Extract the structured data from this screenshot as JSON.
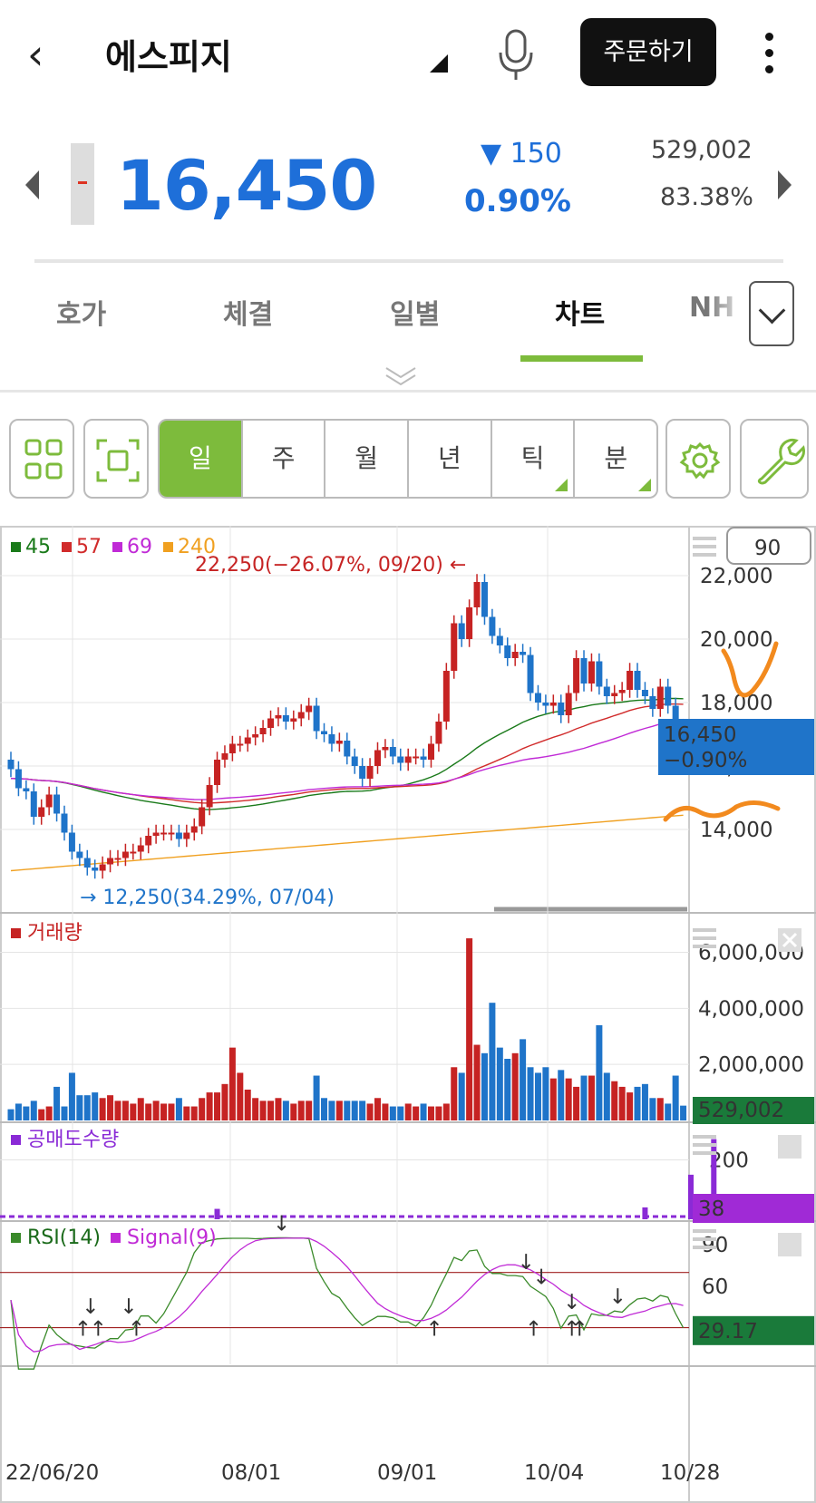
{
  "header": {
    "back_icon": "chevron-left-icon",
    "stock_name": "에스피지",
    "order_button": "주문하기",
    "mic_icon": "microphone-icon",
    "more_icon": "more-vertical-icon"
  },
  "quote": {
    "price": "16,450",
    "change": "▼ 150",
    "change_pct": "0.90%",
    "volume": "529,002",
    "ratio": "83.38%",
    "color": "#1e6fd9"
  },
  "tabs": [
    {
      "label": "호가"
    },
    {
      "label": "체결"
    },
    {
      "label": "일별"
    },
    {
      "label": "차트",
      "active": true
    },
    {
      "label": "NH"
    }
  ],
  "toolbar": {
    "periods": [
      "일",
      "주",
      "월",
      "년",
      "틱",
      "분"
    ],
    "active_period": "일",
    "accent": "#7dbb3c"
  },
  "chart_data": [
    {
      "type": "candlestick",
      "panel": "price",
      "legend": [
        {
          "name": "45",
          "color": "#1a7a1a"
        },
        {
          "name": "57",
          "color": "#d12b2b"
        },
        {
          "name": "69",
          "color": "#c02ad6"
        },
        {
          "name": "240",
          "color": "#f0a020"
        }
      ],
      "period_input": "90",
      "y_ticks": [
        "22,000",
        "20,000",
        "18,000",
        "14,000"
      ],
      "ylim": [
        12000,
        23000
      ],
      "high_annotation": "22,250(−26.07%, 09/20)",
      "low_annotation": "12,250(34.29%, 07/04)",
      "current_label": "16,450",
      "current_change": "−0.90%",
      "current_covered_tick": "16,000",
      "closes": [
        15900,
        15300,
        15200,
        14400,
        14700,
        15100,
        14500,
        13900,
        13300,
        13100,
        12800,
        12700,
        12900,
        13100,
        13100,
        13300,
        13300,
        13500,
        13800,
        13900,
        13900,
        13900,
        13700,
        13900,
        14100,
        14700,
        15400,
        16200,
        16400,
        16700,
        16700,
        16900,
        17000,
        17200,
        17500,
        17600,
        17400,
        17500,
        17700,
        17900,
        17100,
        17000,
        16700,
        16800,
        16300,
        16000,
        15600,
        16000,
        16500,
        16600,
        16300,
        16100,
        16300,
        16300,
        16200,
        16700,
        17400,
        19000,
        20500,
        20000,
        21000,
        21800,
        20700,
        20100,
        19800,
        19400,
        19600,
        19500,
        18300,
        18000,
        17900,
        18000,
        17600,
        18300,
        19400,
        18600,
        19300,
        18500,
        18200,
        18300,
        18400,
        19000,
        18400,
        18200,
        17800,
        18500,
        17900,
        16700,
        16450
      ]
    },
    {
      "type": "bar",
      "panel": "volume",
      "title": "거래량",
      "y_ticks": [
        "6,000,000",
        "4,000,000",
        "2,000,000"
      ],
      "ylim": [
        0,
        6600000
      ],
      "current_label": "529,002",
      "values": [
        400000,
        600000,
        500000,
        700000,
        400000,
        500000,
        1200000,
        500000,
        1700000,
        900000,
        900000,
        1000000,
        800000,
        900000,
        700000,
        700000,
        600000,
        800000,
        600000,
        700000,
        600000,
        600000,
        800000,
        500000,
        500000,
        800000,
        1000000,
        1000000,
        1300000,
        2600000,
        1700000,
        1100000,
        800000,
        700000,
        700000,
        800000,
        700000,
        600000,
        700000,
        700000,
        1600000,
        800000,
        700000,
        700000,
        700000,
        700000,
        700000,
        600000,
        800000,
        600000,
        500000,
        500000,
        600000,
        500000,
        600000,
        500000,
        500000,
        600000,
        1900000,
        1700000,
        6500000,
        2700000,
        2400000,
        4200000,
        2600000,
        2200000,
        2400000,
        2900000,
        1900000,
        1700000,
        1900000,
        1500000,
        1800000,
        1500000,
        1200000,
        1600000,
        1600000,
        3400000,
        1700000,
        1400000,
        1200000,
        1000000,
        1200000,
        1300000,
        800000,
        800000,
        600000,
        1600000,
        529002
      ],
      "colors_up": "#c62323",
      "colors_down": "#1f74c9"
    },
    {
      "type": "bar",
      "panel": "short-selling",
      "title": "공매도수량",
      "y_ticks": [
        "200"
      ],
      "ylim": [
        0,
        290
      ],
      "current_label": "38",
      "values": [
        0,
        0,
        0,
        0,
        0,
        0,
        0,
        0,
        0,
        0,
        0,
        0,
        0,
        0,
        0,
        0,
        0,
        0,
        0,
        0,
        0,
        0,
        0,
        0,
        0,
        0,
        0,
        35,
        0,
        0,
        0,
        0,
        0,
        0,
        0,
        0,
        0,
        0,
        0,
        0,
        0,
        0,
        0,
        0,
        0,
        0,
        0,
        0,
        0,
        0,
        0,
        0,
        0,
        0,
        0,
        0,
        0,
        0,
        0,
        0,
        0,
        0,
        0,
        0,
        0,
        0,
        0,
        0,
        0,
        0,
        0,
        0,
        0,
        0,
        0,
        0,
        0,
        0,
        0,
        0,
        0,
        0,
        0,
        40,
        0,
        0,
        0,
        0,
        0,
        150,
        0,
        0,
        270,
        38
      ]
    },
    {
      "type": "line",
      "panel": "rsi",
      "series": [
        {
          "name": "RSI(14)",
          "color": "#3a8a2a"
        },
        {
          "name": "Signal(9)",
          "color": "#c02ad6"
        }
      ],
      "y_ticks": [
        "90",
        "60"
      ],
      "ylim": [
        10,
        100
      ],
      "hlines": [
        70,
        30
      ],
      "current_label": "29.17"
    }
  ],
  "x_ticks": [
    "22/06/20",
    "08/01",
    "09/01",
    "10/04",
    "10/28"
  ],
  "icons": {
    "grid": "grid-icon",
    "fullscreen": "fullscreen-icon",
    "settings": "gear-icon",
    "tools": "wrench-icon",
    "menu": "hamburger-icon",
    "close": "close-icon",
    "chevron_down": "chevron-down-icon"
  }
}
